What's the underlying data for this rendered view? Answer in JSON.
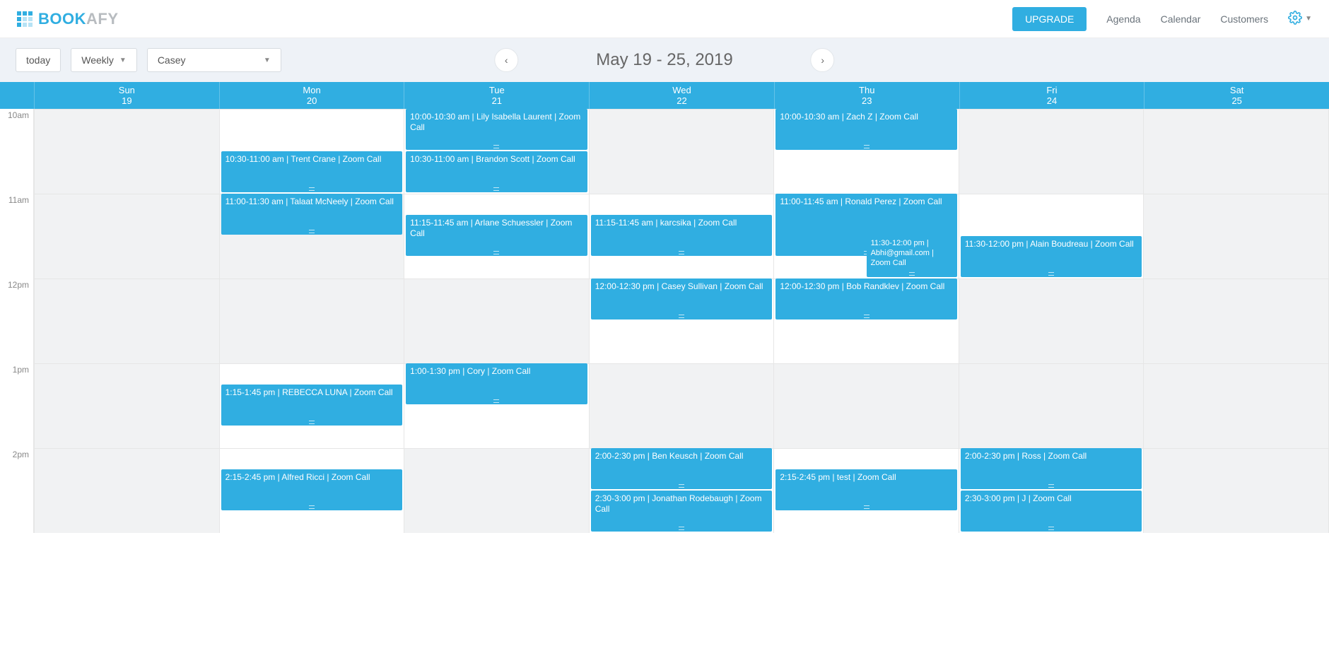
{
  "brand": {
    "part1": "BOOK",
    "part2": "AFY"
  },
  "nav": {
    "upgrade": "UPGRADE",
    "links": [
      "Agenda",
      "Calendar",
      "Customers"
    ]
  },
  "controls": {
    "today": "today",
    "view": "Weekly",
    "staff": "Casey"
  },
  "dateRange": "May 19 - 25, 2019",
  "days": [
    {
      "dow": "Sun",
      "num": "19"
    },
    {
      "dow": "Mon",
      "num": "20"
    },
    {
      "dow": "Tue",
      "num": "21"
    },
    {
      "dow": "Wed",
      "num": "22"
    },
    {
      "dow": "Thu",
      "num": "23"
    },
    {
      "dow": "Fri",
      "num": "24"
    },
    {
      "dow": "Sat",
      "num": "25"
    }
  ],
  "hours": [
    "10am",
    "11am",
    "12pm",
    "1pm",
    "2pm"
  ],
  "hourStart": 10,
  "pxPerHour": 120,
  "freeSlots": {
    "0": [],
    "1": [
      10,
      13,
      14
    ],
    "2": [
      10,
      11,
      13
    ],
    "3": [
      11,
      12,
      14
    ],
    "4": [
      10,
      11,
      12,
      14
    ],
    "5": [
      11,
      14
    ],
    "6": []
  },
  "events": [
    {
      "day": 1,
      "startMin": 630,
      "endMin": 660,
      "label": "10:30-11:00 am | Trent Crane | Zoom Call"
    },
    {
      "day": 1,
      "startMin": 660,
      "endMin": 690,
      "label": "11:00-11:30 am | Talaat McNeely | Zoom Call"
    },
    {
      "day": 1,
      "startMin": 795,
      "endMin": 825,
      "label": "1:15-1:45 pm | REBECCA LUNA | Zoom Call"
    },
    {
      "day": 1,
      "startMin": 855,
      "endMin": 885,
      "label": "2:15-2:45 pm | Alfred Ricci | Zoom Call"
    },
    {
      "day": 2,
      "startMin": 600,
      "endMin": 630,
      "label": "10:00-10:30 am | Lily Isabella Laurent | Zoom Call"
    },
    {
      "day": 2,
      "startMin": 630,
      "endMin": 660,
      "label": "10:30-11:00 am | Brandon Scott | Zoom Call"
    },
    {
      "day": 2,
      "startMin": 675,
      "endMin": 705,
      "label": "11:15-11:45 am | Arlane Schuessler | Zoom Call"
    },
    {
      "day": 2,
      "startMin": 780,
      "endMin": 810,
      "label": "1:00-1:30 pm | Cory | Zoom Call"
    },
    {
      "day": 3,
      "startMin": 675,
      "endMin": 705,
      "label": "11:15-11:45 am | karcsika | Zoom Call"
    },
    {
      "day": 3,
      "startMin": 720,
      "endMin": 750,
      "label": "12:00-12:30 pm | Casey Sullivan | Zoom Call"
    },
    {
      "day": 3,
      "startMin": 840,
      "endMin": 870,
      "label": "2:00-2:30 pm | Ben Keusch | Zoom Call"
    },
    {
      "day": 3,
      "startMin": 870,
      "endMin": 900,
      "label": "2:30-3:00 pm | Jonathan Rodebaugh | Zoom Call"
    },
    {
      "day": 4,
      "startMin": 600,
      "endMin": 630,
      "label": "10:00-10:30 am | Zach Z | Zoom Call"
    },
    {
      "day": 4,
      "startMin": 660,
      "endMin": 705,
      "label": "11:00-11:45 am | Ronald Perez | Zoom Call"
    },
    {
      "day": 4,
      "startMin": 690,
      "endMin": 720,
      "label": "11:30-12:00 pm | Abhi@gmail.com | Zoom Call",
      "narrow": true
    },
    {
      "day": 4,
      "startMin": 720,
      "endMin": 750,
      "label": "12:00-12:30 pm | Bob Randklev | Zoom Call"
    },
    {
      "day": 4,
      "startMin": 855,
      "endMin": 885,
      "label": "2:15-2:45 pm | test | Zoom Call"
    },
    {
      "day": 5,
      "startMin": 690,
      "endMin": 720,
      "label": "11:30-12:00 pm | Alain Boudreau | Zoom Call"
    },
    {
      "day": 5,
      "startMin": 840,
      "endMin": 870,
      "label": "2:00-2:30 pm | Ross | Zoom Call"
    },
    {
      "day": 5,
      "startMin": 870,
      "endMin": 900,
      "label": "2:30-3:00 pm | J | Zoom Call"
    }
  ]
}
